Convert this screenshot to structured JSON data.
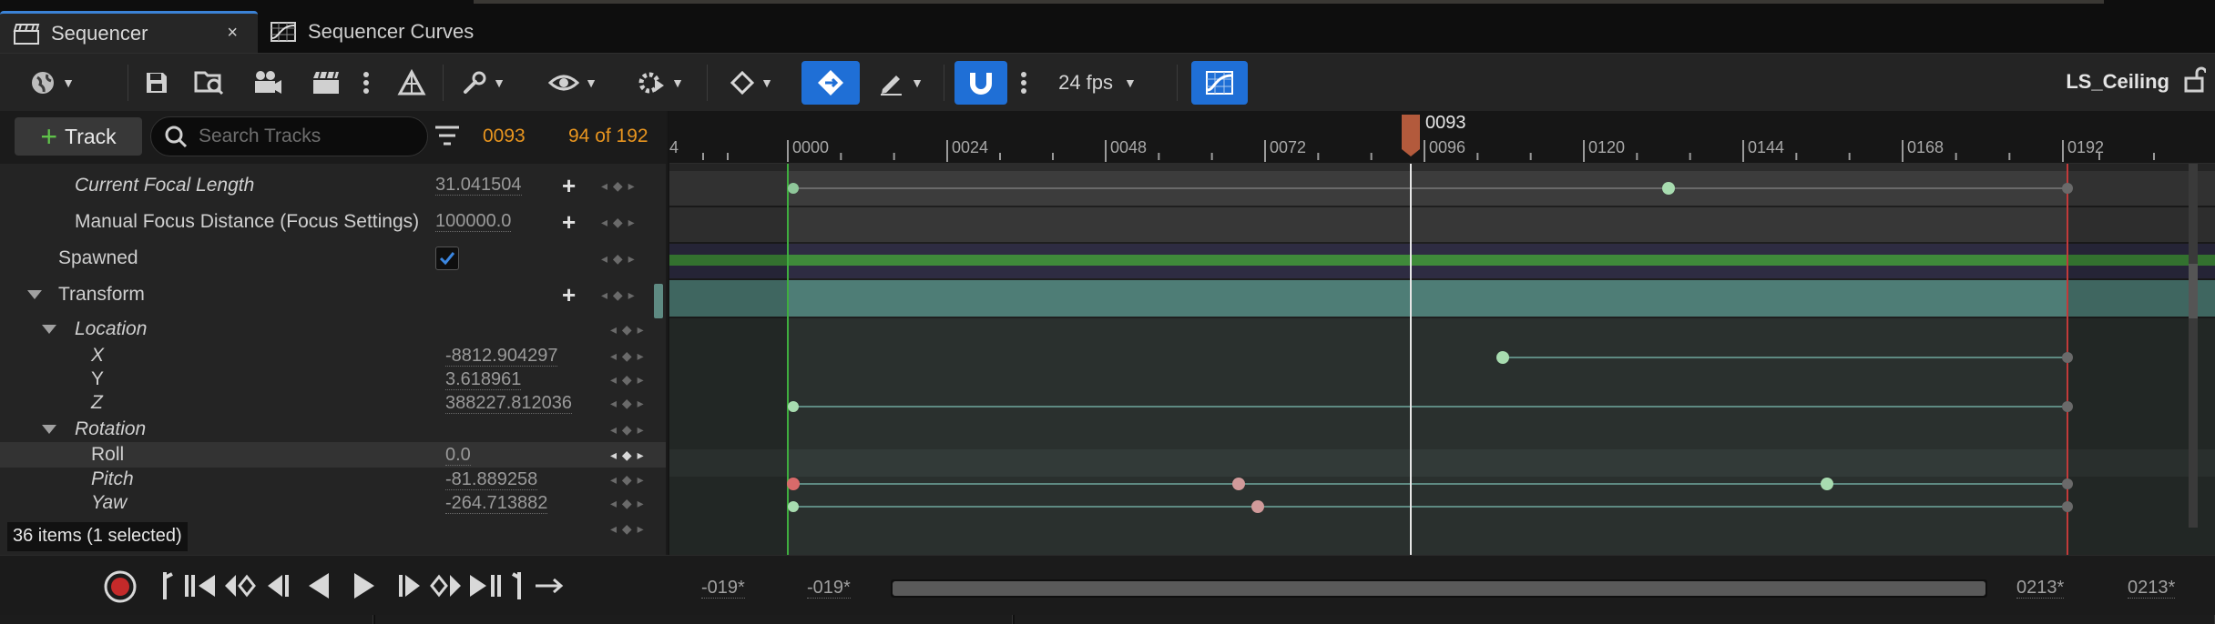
{
  "tabs": [
    {
      "label": "Sequencer",
      "close": "×"
    },
    {
      "label": "Sequencer Curves"
    }
  ],
  "toolbar": {
    "fps": "24 fps",
    "sequence_name": "LS_Ceiling"
  },
  "left": {
    "add_track": "Track",
    "search_placeholder": "Search Tracks",
    "current_frame": "0093",
    "frame_count": "94 of 192",
    "status": "36 items (1 selected)",
    "rows": [
      {
        "label": "Current Focal Length",
        "value": "31.041504"
      },
      {
        "label": "Manual Focus Distance (Focus Settings)",
        "value": "100000.0"
      },
      {
        "label": "Spawned"
      },
      {
        "label": "Transform"
      },
      {
        "label": "Location"
      },
      {
        "label": "X",
        "value": "-8812.904297"
      },
      {
        "label": "Y",
        "value": "3.618961"
      },
      {
        "label": "Z",
        "value": "388227.812036"
      },
      {
        "label": "Rotation"
      },
      {
        "label": "Roll",
        "value": "0.0"
      },
      {
        "label": "Pitch",
        "value": "-81.889258"
      },
      {
        "label": "Yaw",
        "value": "-264.713882"
      }
    ]
  },
  "ruler": {
    "left_edge": "4",
    "ticks": [
      "0000",
      "0024",
      "0048",
      "0072",
      "0096",
      "0120",
      "0144",
      "0168",
      "0192"
    ],
    "playhead": "0093"
  },
  "transport": {
    "view_start": "-019*",
    "work_start": "-019*",
    "work_end": "0213*",
    "view_end": "0213*"
  },
  "colors": {
    "accent_blue": "#1f6fd6",
    "frame_orange": "#e8951f",
    "start_marker": "#3fae3f",
    "end_marker": "#c23a3a",
    "playhead": "#b35a3c"
  }
}
